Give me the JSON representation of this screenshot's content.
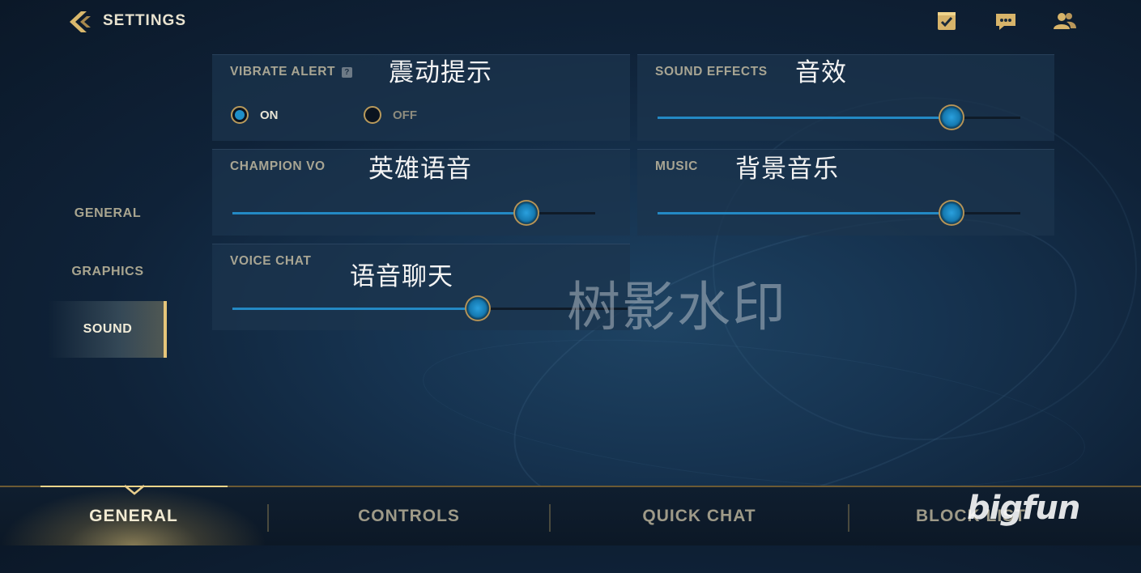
{
  "header": {
    "title": "SETTINGS",
    "back_icon": "chevron-left-icon",
    "icons": [
      "checklist-icon",
      "chat-icon",
      "friends-icon"
    ]
  },
  "sidebar": {
    "items": [
      {
        "label": "GENERAL",
        "active": false
      },
      {
        "label": "GRAPHICS",
        "active": false
      },
      {
        "label": "SOUND",
        "active": true
      }
    ]
  },
  "settings": {
    "vibrate_alert": {
      "label": "VIBRATE ALERT",
      "help": "?",
      "annotation": "震动提示",
      "on_label": "ON",
      "off_label": "OFF",
      "value": "ON"
    },
    "sound_effects": {
      "label": "SOUND EFFECTS",
      "annotation": "音效",
      "value": 0.81
    },
    "champion_vo": {
      "label": "CHAMPION VO",
      "annotation": "英雄语音",
      "value": 0.81
    },
    "music": {
      "label": "MUSIC",
      "annotation": "背景音乐",
      "value": 0.81
    },
    "voice_chat": {
      "label": "VOICE CHAT",
      "annotation": "语音聊天",
      "value": 0.62
    }
  },
  "bottom_tabs": [
    {
      "label": "GENERAL",
      "active": true
    },
    {
      "label": "CONTROLS",
      "active": false
    },
    {
      "label": "QUICK CHAT",
      "active": false
    },
    {
      "label": "BLOCK LIST",
      "active": false
    }
  ],
  "overlays": {
    "watermark": "树影水印",
    "brand": "bigfun"
  },
  "colors": {
    "accent_gold": "#e6c57a",
    "accent_blue": "#2389c4"
  }
}
